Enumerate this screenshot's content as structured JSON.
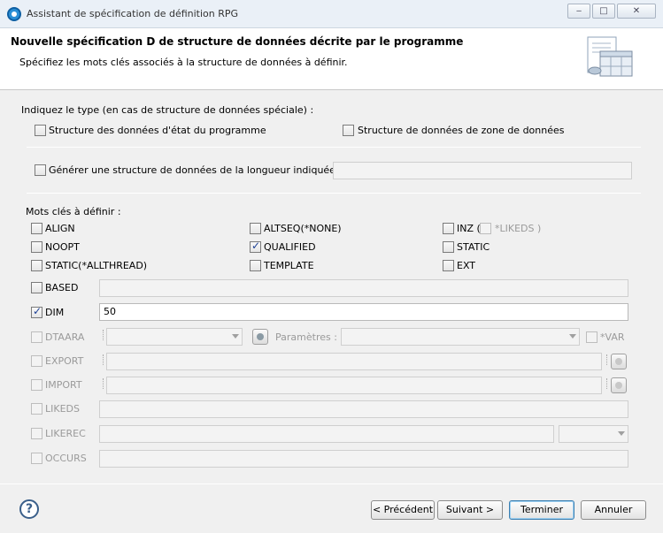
{
  "window": {
    "title": "Assistant de spécification de définition RPG",
    "minimize_glyph": "‒",
    "maximize_glyph": "□",
    "close_glyph": "✕"
  },
  "header": {
    "title": "Nouvelle spécification D de structure de données décrite par le programme",
    "subtitle": "Spécifiez les mots clés associés à la structure de données à définir.",
    "icon": "document-table-icon"
  },
  "type_section": {
    "label": "Indiquez le type (en cas de structure de données spéciale) :",
    "program_status": {
      "label": "Structure des données d'état du programme",
      "checked": false
    },
    "data_area": {
      "label": "Structure de données de zone de données",
      "checked": false
    }
  },
  "length_section": {
    "label": "Générer une structure de données de la longueur indiquée",
    "checked": false,
    "value": ""
  },
  "keywords": {
    "label": "Mots clés à définir :",
    "align": {
      "label": "ALIGN",
      "checked": false
    },
    "altseq": {
      "label": "ALTSEQ(*NONE)",
      "checked": false
    },
    "inz": {
      "label": "INZ (",
      "checked": false
    },
    "inz_likeds": {
      "label": "*LIKEDS )",
      "checked": false
    },
    "noopt": {
      "label": "NOOPT",
      "checked": false
    },
    "qualified": {
      "label": "QUALIFIED",
      "checked": true
    },
    "static": {
      "label": "STATIC",
      "checked": false
    },
    "static_allthread": {
      "label": "STATIC(*ALLTHREAD)",
      "checked": false
    },
    "template": {
      "label": "TEMPLATE",
      "checked": false
    },
    "ext": {
      "label": "EXT",
      "checked": false
    },
    "based": {
      "label": "BASED",
      "checked": false,
      "value": ""
    },
    "dim": {
      "label": "DIM",
      "checked": true,
      "value": "50"
    },
    "dtaara": {
      "label": "DTAARA",
      "checked": false,
      "value": "",
      "params_label": "Paramètres :",
      "params_value": "",
      "var_label": "*VAR",
      "var_checked": false
    },
    "export": {
      "label": "EXPORT",
      "checked": false,
      "value": ""
    },
    "import": {
      "label": "IMPORT",
      "checked": false,
      "value": ""
    },
    "likeds": {
      "label": "LIKEDS",
      "checked": false,
      "value": ""
    },
    "likerec": {
      "label": "LIKEREC",
      "checked": false,
      "value": "",
      "option": ""
    },
    "occurs": {
      "label": "OCCURS",
      "checked": false,
      "value": ""
    }
  },
  "footer": {
    "help": "?",
    "back": "< Précédent",
    "next": "Suivant >",
    "finish": "Terminer",
    "cancel": "Annuler"
  }
}
